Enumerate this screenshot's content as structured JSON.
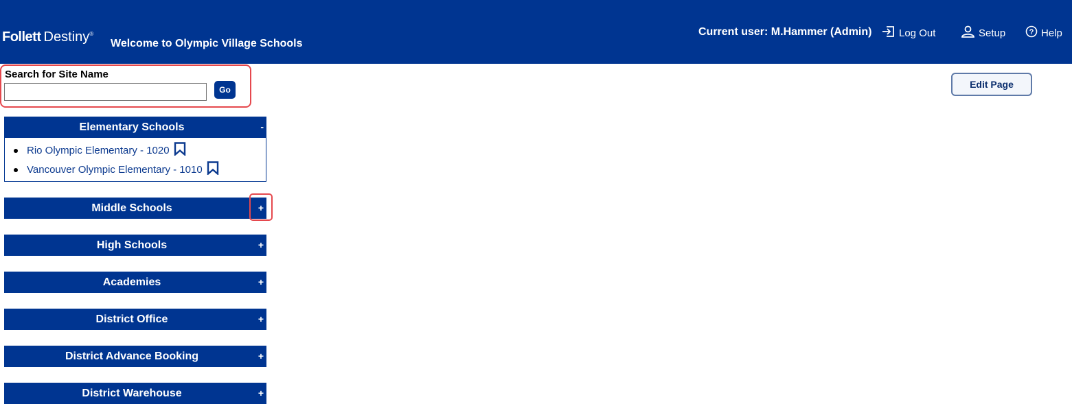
{
  "header": {
    "brand": "Follett",
    "product": "Destiny",
    "trademark": "®",
    "welcome": "Welcome to Olympic Village Schools",
    "current_user": "Current user: M.Hammer (Admin)",
    "logout_label": "Log Out",
    "setup_label": "Setup",
    "help_label": "Help",
    "background_color": "#003591"
  },
  "search": {
    "label": "Search for Site Name",
    "value": "",
    "placeholder": "",
    "go_label": "Go"
  },
  "edit_page_label": "Edit Page",
  "sections": [
    {
      "title": "Elementary Schools",
      "toggle": "-",
      "expanded": true,
      "items": [
        "Rio Olympic Elementary - 1020",
        "Vancouver Olympic Elementary - 1010"
      ]
    },
    {
      "title": "Middle Schools",
      "toggle": "+",
      "expanded": false
    },
    {
      "title": "High Schools",
      "toggle": "+",
      "expanded": false
    },
    {
      "title": "Academies",
      "toggle": "+",
      "expanded": false
    },
    {
      "title": "District Office",
      "toggle": "+",
      "expanded": false
    },
    {
      "title": "District Advance Booking",
      "toggle": "+",
      "expanded": false
    },
    {
      "title": "District Warehouse",
      "toggle": "+",
      "expanded": false
    }
  ],
  "icons": {
    "logout": "logout-icon",
    "setup": "user-icon",
    "help": "help-icon",
    "bookmark": "bookmark-icon"
  },
  "colors": {
    "accent": "#003591",
    "link": "#0c3a8f",
    "highlight": "#e5484d"
  }
}
